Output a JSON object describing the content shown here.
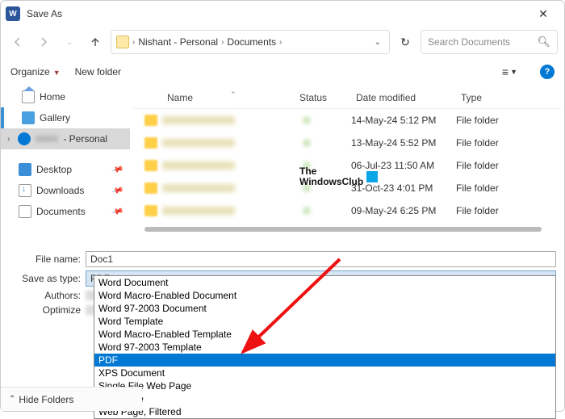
{
  "titlebar": {
    "title": "Save As"
  },
  "nav": {
    "path": {
      "root": "Nishant - Personal",
      "folder": "Documents"
    },
    "search_placeholder": "Search Documents"
  },
  "toolbar": {
    "organize": "Organize",
    "new_folder": "New folder"
  },
  "sidebar": {
    "home": "Home",
    "gallery": "Gallery",
    "onedrive": "- Personal",
    "desktop": "Desktop",
    "downloads": "Downloads",
    "documents": "Documents"
  },
  "columns": {
    "name": "Name",
    "status": "Status",
    "date": "Date modified",
    "type": "Type"
  },
  "rows": [
    {
      "date": "14-May-24 5:12 PM",
      "type": "File folder"
    },
    {
      "date": "13-May-24 5:52 PM",
      "type": "File folder"
    },
    {
      "date": "06-Jul-23 11:50 AM",
      "type": "File folder"
    },
    {
      "date": "31-Oct-23 4:01 PM",
      "type": "File folder"
    },
    {
      "date": "09-May-24 6:25 PM",
      "type": "File folder"
    }
  ],
  "watermark": {
    "line1": "The",
    "line2": "WindowsClub"
  },
  "form": {
    "file_name_label": "File name:",
    "file_name_value": "Doc1",
    "save_as_type_label": "Save as type:",
    "save_as_type_value": "PDF",
    "authors_label": "Authors:",
    "optimize_label": "Optimize"
  },
  "dropdown": {
    "options": [
      "Word Document",
      "Word Macro-Enabled Document",
      "Word 97-2003 Document",
      "Word Template",
      "Word Macro-Enabled Template",
      "Word 97-2003 Template",
      "PDF",
      "XPS Document",
      "Single File Web Page",
      "Web Page",
      "Web Page, Filtered"
    ],
    "selected_index": 6
  },
  "footer": {
    "hide_folders": "Hide Folders"
  }
}
